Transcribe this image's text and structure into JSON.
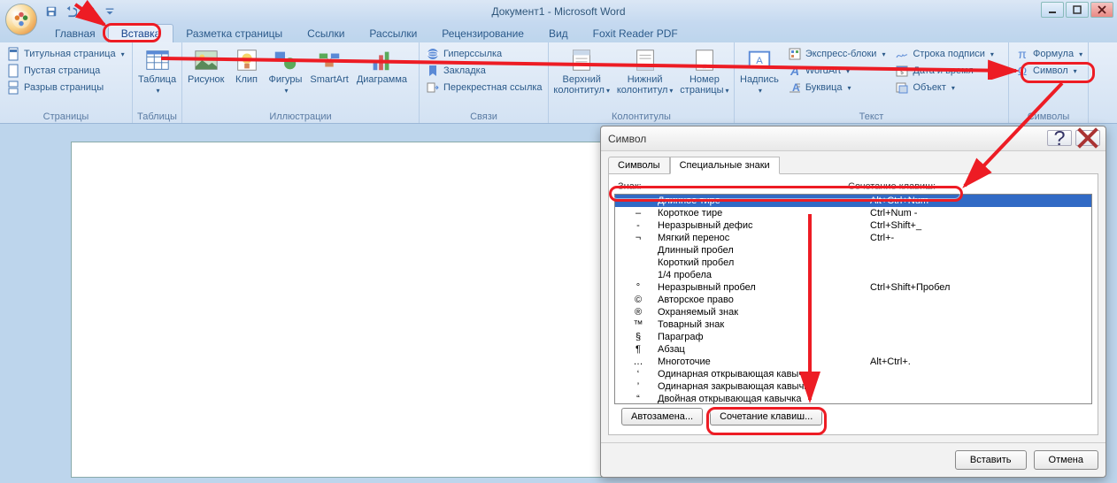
{
  "window_title": "Документ1 - Microsoft Word",
  "qat": {
    "save": "save",
    "undo": "undo",
    "redo": "redo",
    "more": "more"
  },
  "tabs": [
    "Главная",
    "Вставка",
    "Разметка страницы",
    "Ссылки",
    "Рассылки",
    "Рецензирование",
    "Вид",
    "Foxit Reader PDF"
  ],
  "active_tab": 1,
  "ribbon": {
    "pages": {
      "label": "Страницы",
      "cover": "Титульная страница",
      "blank": "Пустая страница",
      "break": "Разрыв страницы"
    },
    "tables": {
      "label": "Таблицы",
      "table": "Таблица"
    },
    "illus": {
      "label": "Иллюстрации",
      "picture": "Рисунок",
      "clip": "Клип",
      "shapes": "Фигуры",
      "smartart": "SmartArt",
      "chart": "Диаграмма"
    },
    "links": {
      "label": "Связи",
      "hyperlink": "Гиперссылка",
      "bookmark": "Закладка",
      "crossref": "Перекрестная ссылка"
    },
    "headfoot": {
      "label": "Колонтитулы",
      "header": "Верхний\nколонтитул",
      "footer": "Нижний\nколонтитул",
      "pagenum": "Номер\nстраницы"
    },
    "textgrp": {
      "label": "Текст",
      "textbox": "Надпись",
      "quick": "Экспресс-блоки",
      "wordart": "WordArt",
      "dropcap": "Буквица",
      "sig": "Строка подписи",
      "date": "Дата и время",
      "obj": "Объект"
    },
    "symbols": {
      "label": "Символы",
      "formula": "Формула",
      "symbol": "Символ"
    }
  },
  "dialog": {
    "title": "Символ",
    "tabs": [
      "Символы",
      "Специальные знаки"
    ],
    "active_tab": 1,
    "header_char": "Знак:",
    "header_keys": "Сочетание клавиш:",
    "rows": [
      {
        "glyph": "—",
        "name": "Длинное тире",
        "keys": "Alt+Ctrl+Num -",
        "sel": true
      },
      {
        "glyph": "–",
        "name": "Короткое тире",
        "keys": "Ctrl+Num -"
      },
      {
        "glyph": "-",
        "name": "Неразрывный дефис",
        "keys": "Ctrl+Shift+_"
      },
      {
        "glyph": "¬",
        "name": "Мягкий перенос",
        "keys": "Ctrl+-"
      },
      {
        "glyph": "",
        "name": "Длинный пробел",
        "keys": ""
      },
      {
        "glyph": "",
        "name": "Короткий пробел",
        "keys": ""
      },
      {
        "glyph": "",
        "name": "1/4 пробела",
        "keys": ""
      },
      {
        "glyph": "°",
        "name": "Неразрывный пробел",
        "keys": "Ctrl+Shift+Пробел"
      },
      {
        "glyph": "©",
        "name": "Авторское право",
        "keys": ""
      },
      {
        "glyph": "®",
        "name": "Охраняемый знак",
        "keys": ""
      },
      {
        "glyph": "™",
        "name": "Товарный знак",
        "keys": ""
      },
      {
        "glyph": "§",
        "name": "Параграф",
        "keys": ""
      },
      {
        "glyph": "¶",
        "name": "Абзац",
        "keys": ""
      },
      {
        "glyph": "…",
        "name": "Многоточие",
        "keys": "Alt+Ctrl+."
      },
      {
        "glyph": "‘",
        "name": "Одинарная открывающая кавычка",
        "keys": ""
      },
      {
        "glyph": "’",
        "name": "Одинарная закрывающая кавычка",
        "keys": ""
      },
      {
        "glyph": "“",
        "name": "Двойная открывающая кавычка",
        "keys": ""
      }
    ],
    "autocorrect": "Автозамена...",
    "shortcut": "Сочетание клавиш...",
    "insert": "Вставить",
    "cancel": "Отмена"
  }
}
